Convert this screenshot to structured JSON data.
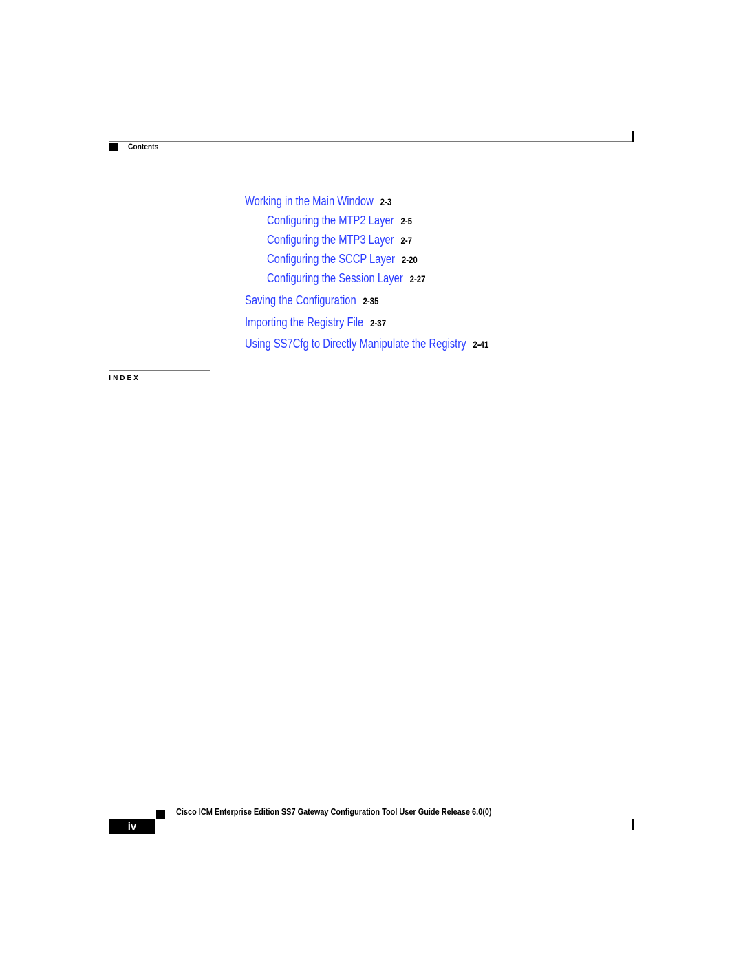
{
  "header": {
    "section_label": "Contents"
  },
  "toc": {
    "entries": [
      {
        "title": "Working in the Main Window",
        "page": "2-3",
        "level": 1
      },
      {
        "title": "Configuring the MTP2 Layer",
        "page": "2-5",
        "level": 2
      },
      {
        "title": "Configuring the MTP3 Layer",
        "page": "2-7",
        "level": 2
      },
      {
        "title": "Configuring the SCCP Layer",
        "page": "2-20",
        "level": 2
      },
      {
        "title": "Configuring the Session Layer",
        "page": "2-27",
        "level": 2
      },
      {
        "title": "Saving the Configuration",
        "page": "2-35",
        "level": 1
      },
      {
        "title": "Importing the Registry File",
        "page": "2-37",
        "level": 1
      },
      {
        "title": "Using SS7Cfg to Directly Manipulate the Registry",
        "page": "2-41",
        "level": 1
      }
    ]
  },
  "index": {
    "label_first": "I",
    "label_rest": "NDEX"
  },
  "footer": {
    "doc_title": "Cisco ICM Enterprise Edition SS7 Gateway Configuration Tool User Guide Release 6.0(0)",
    "page_number": "iv"
  },
  "colors": {
    "link": "#2a3cff",
    "text": "#000000",
    "rule": "#7a7a7a"
  }
}
